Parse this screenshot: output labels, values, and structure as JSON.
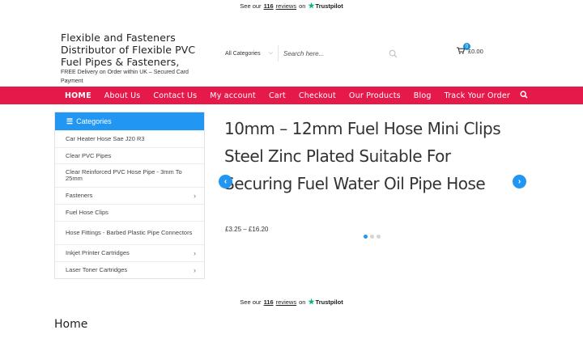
{
  "trustpilot": {
    "prefix": "See our",
    "count": "116",
    "reviews": "reviews",
    "on": "on",
    "brand": "Trustpilot"
  },
  "header": {
    "site_title": "Flexible and Fasteners Distributor of Flexible PVC Fuel Pipes & Fasteners,",
    "tagline": "FREE Delivery on Order within UK – Secured Card Payment"
  },
  "search": {
    "category": "All Categories",
    "placeholder": "Search here..."
  },
  "cart": {
    "count": "0",
    "total": "£0.00"
  },
  "nav": {
    "items": [
      "HOME",
      "About Us",
      "Contact Us",
      "My account",
      "Cart",
      "Checkout",
      "Our Products",
      "Blog",
      "Track Your Order"
    ]
  },
  "categories": {
    "heading": "Categories",
    "items": [
      {
        "label": "Car Heater Hose Sae J20 R3",
        "has_children": false
      },
      {
        "label": "Clear PVC Pipes",
        "has_children": false
      },
      {
        "label": "Clear Reinforced PVC Hose Pipe - 3mm To 25mm",
        "has_children": false
      },
      {
        "label": "Fasteners",
        "has_children": true
      },
      {
        "label": "Fuel Hose Clips",
        "has_children": false
      },
      {
        "label": "Hose Fittings - Barbed Plastic Pipe Connectors",
        "has_children": false
      },
      {
        "label": "Inkjet Printer Cartridges",
        "has_children": true
      },
      {
        "label": "Laser Toner Cartridges",
        "has_children": true
      }
    ]
  },
  "slider": {
    "title": "10mm – 12mm Fuel Hose Mini Clips Steel Zinc Plated Suitable For Securing Fuel Water Oil Pipe Hose",
    "price": "£3.25 – £16.20",
    "slide_count": 3,
    "active_slide": 1
  },
  "main": {
    "heading": "Home"
  },
  "colors": {
    "nav_bg": "#e6194b",
    "accent": "#2196f3",
    "trustpilot_star": "#00b67a"
  }
}
